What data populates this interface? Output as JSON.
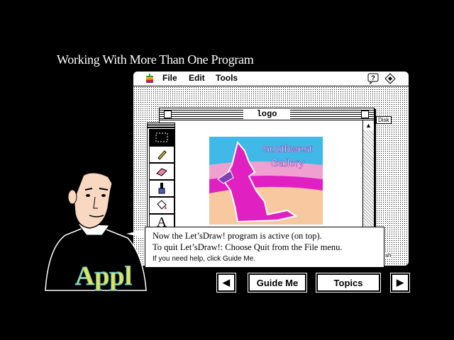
{
  "lesson": {
    "title": "Working With More Than One Program"
  },
  "mac": {
    "menu": [
      "File",
      "Edit",
      "Tools"
    ],
    "icons": [
      "apple-icon",
      "help-icon",
      "application-icon"
    ]
  },
  "document": {
    "title": "logo",
    "art_text_line1": "Southwest",
    "art_text_line2": "Gallery",
    "tools": [
      "selection-rectangle-icon",
      "pencil-icon",
      "eraser-icon",
      "paintbrush-icon",
      "paint-bucket-icon",
      "text-tool-icon",
      "line-width-icon"
    ],
    "text_tool_label": "A"
  },
  "desktop": {
    "disk_label": "Disk",
    "side_label": "sh"
  },
  "speech": {
    "line1": "Now the Let’sDraw! program is active (on top).",
    "line2": "To quit Let’sDraw!: Choose Quit from the File menu.",
    "help": "If you need help, click Guide Me."
  },
  "guide": {
    "shirt_text": "Appl"
  },
  "nav": {
    "back_label": "◀",
    "guide_me_label": "Guide Me",
    "topics_label": "Topics",
    "forward_label": "▶"
  },
  "colors": {
    "logo_magenta": "#e020c0",
    "logo_purple": "#8040b0",
    "logo_sand": "#f8c8a0",
    "logo_sky": "#40b8e8",
    "logo_pink": "#f0a0d0"
  }
}
